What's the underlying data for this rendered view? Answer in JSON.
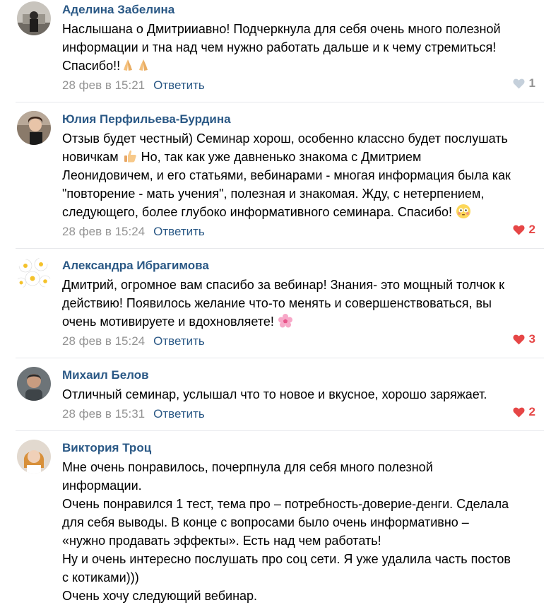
{
  "comments": [
    {
      "author": "Аделина Забелина",
      "lines": [
        "Наслышана о Дмитрииавно! Подчеркнула для себя очень много полезной",
        "информации и тна над чем нужно работать дальше и к чему стремиться!",
        "Спасибо!!"
      ],
      "date": "28 фев в 15:21",
      "reply": "Ответить",
      "likes": "1",
      "liked": false
    },
    {
      "author": "Юлия Перфильева-Бурдина",
      "lines": [
        "Отзыв будет честный) Семинар хорош, особенно классно будет послушать",
        "новичкам",
        "Но, так как уже давненько знакома с Дмитрием",
        "Леонидовичем, и его статьями, вебинарами - многая информация была как",
        "\"повторение - мать учения\", полезная и знакомая. Жду, с нетерпением,",
        "следующего, более глубоко информативного семинара. Спасибо!"
      ],
      "date": "28 фев в 15:24",
      "reply": "Ответить",
      "likes": "2",
      "liked": true
    },
    {
      "author": "Александра Ибрагимова",
      "lines": [
        "Дмитрий, огромное вам спасибо за вебинар! Знания- это мощный толчок к",
        "действию! Появилось желание что-то менять и совершенствоваться, вы",
        "очень мотивируете и вдохновляете!"
      ],
      "date": "28 фев в 15:24",
      "reply": "Ответить",
      "likes": "3",
      "liked": true
    },
    {
      "author": "Михаил Белов",
      "lines": [
        "Отличный семинар, услышал что то новое и вкусное, хорошо заряжает."
      ],
      "date": "28 фев в 15:31",
      "reply": "Ответить",
      "likes": "2",
      "liked": true
    },
    {
      "author": "Виктория Троц",
      "lines": [
        "Мне очень понравилось, почерпнула для себя много полезной",
        "информации.",
        "Очень понравился 1 тест, тема про – потребность-доверие-денги. Сделала",
        "для себя выводы. В конце с вопросами было очень информативно –",
        "«нужно продавать эффекты». Есть над чем работать!",
        "Ну и очень интересно послушать про соц сети. Я уже удалила часть постов",
        "с котиками)))",
        "Очень хочу следующий вебинар."
      ]
    }
  ],
  "colors": {
    "author": "#2a5885",
    "date": "#939393",
    "like_red": "#e64646",
    "like_gray": "#939393",
    "divider": "#e7e8ec"
  },
  "icons": [
    "praying-hands-icon",
    "thumbs-up-icon",
    "flushed-face-icon",
    "cherry-blossom-icon",
    "heart-icon"
  ]
}
